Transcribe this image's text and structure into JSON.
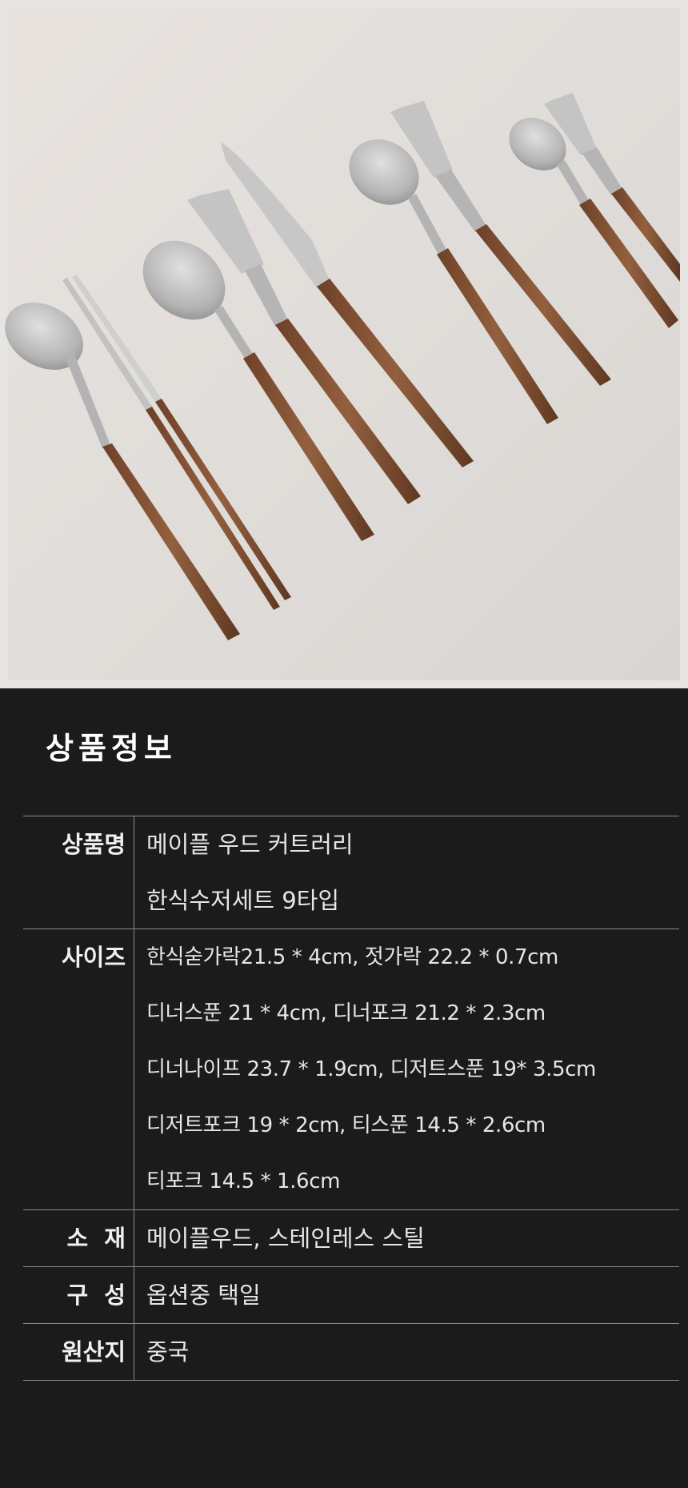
{
  "photo": {
    "subject": "maple-wood-cutlery-photo"
  },
  "product_info": {
    "title": "상품정보",
    "rows": [
      {
        "label": "상품명",
        "values": [
          "메이플 우드 커트러리",
          "한식수저세트 9타입"
        ]
      },
      {
        "label": "사이즈",
        "values": [
          "한식숟가락21.5 * 4cm, 젓가락 22.2 * 0.7cm",
          "디너스푼 21 * 4cm, 디너포크 21.2 * 2.3cm",
          "디너나이프 23.7 * 1.9cm, 디저트스푼 19* 3.5cm",
          "디저트포크 19 * 2cm, 티스푼 14.5 * 2.6cm",
          "티포크 14.5 * 1.6cm"
        ]
      },
      {
        "label": "소  재",
        "values": [
          "메이플우드, 스테인레스 스틸"
        ]
      },
      {
        "label": "구  성",
        "values": [
          "옵션중 택일"
        ]
      },
      {
        "label": "원산지",
        "values": [
          "중국"
        ]
      }
    ]
  },
  "colors": {
    "background": "#1b1b1b",
    "photo_background": "#e7e5e2",
    "wood": "#8c5a3b",
    "steel": "#bdbdbd",
    "text": "#e9e9e9",
    "rule": "#8a8a8a"
  }
}
